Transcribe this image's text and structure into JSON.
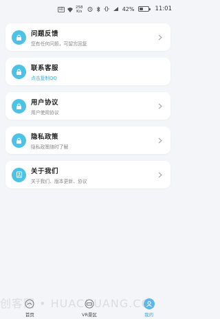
{
  "status_bar": {
    "speed_value": "258",
    "speed_unit": "K/s",
    "battery": "42%",
    "time": "11:01",
    "icons": [
      "sim-icon",
      "wifi-icon",
      "alarm-icon",
      "bluetooth-icon",
      "vibrate-icon",
      "signal-icon",
      "battery-icon"
    ]
  },
  "menu": {
    "items": [
      {
        "title": "问题反馈",
        "subtitle": "您有任何问题，可留言回复",
        "icon": "lock-icon"
      },
      {
        "title": "联系客服",
        "subtitle": "点击复制QQ",
        "icon": "lock-icon",
        "subtitle_color": "#35b4df"
      },
      {
        "title": "用户协议",
        "subtitle": "用户使用协议",
        "icon": "lock-icon"
      },
      {
        "title": "隐私政策",
        "subtitle": "隐私政策随时了解",
        "icon": "lock-icon"
      },
      {
        "title": "关于我们",
        "subtitle": "关于我们、版本更新、协议",
        "icon": "info-icon"
      }
    ]
  },
  "watermark": "创客网 • HUACHUANG.CO",
  "tabbar": {
    "tabs": [
      {
        "label": "首页",
        "icon": "home-icon"
      },
      {
        "label": "VR景区",
        "icon": "vr-icon"
      },
      {
        "label": "我的",
        "icon": "profile-icon",
        "active": true
      }
    ]
  },
  "colors": {
    "accent": "#4cc3e6",
    "background": "#f3f5f8",
    "active_tab": "#3aa7e6"
  }
}
